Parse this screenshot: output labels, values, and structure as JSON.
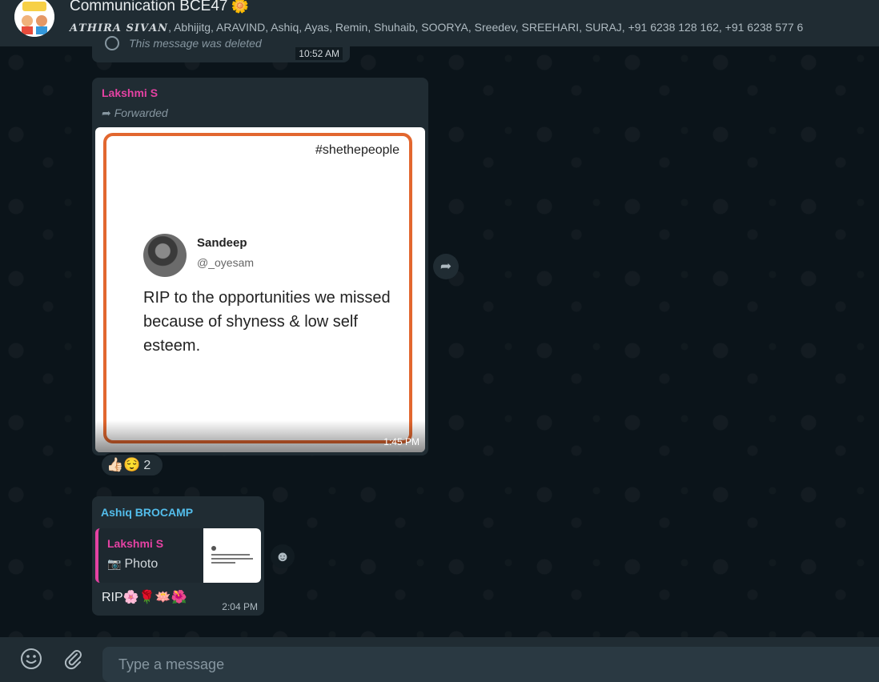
{
  "header": {
    "title": "Communication BCE47",
    "title_emoji": "🌼",
    "members_fancy": "𝑨𝑻𝑯𝑰𝑹𝑨 𝑺𝑰𝑽𝑨𝑵",
    "members_rest": ", Abhijitg, ARAVIND, Ashiq, Ayas, Remin, Shuhaib, SOORYA, Sreedev, SREEHARI, SURAJ, +91 6238 128 162, +91 6238 577 6",
    "avatar_text": "LET'S SPEAK!"
  },
  "messages": {
    "deleted": {
      "text": "This message was deleted",
      "time": "10:52 AM"
    },
    "image_message": {
      "sender": "Lakshmi S",
      "sender_color": "#e542a3",
      "forwarded_label": "Forwarded",
      "time": "1:45 PM",
      "image": {
        "hashtag": "#shethepeople",
        "author_name": "Sandeep",
        "author_handle": "@_oyesam",
        "tweet_text": "RIP to the opportunities we missed because of shyness & low self esteem."
      },
      "reactions": {
        "emojis": "👍🏻😌",
        "count": "2"
      }
    },
    "reply_message": {
      "sender": "Ashiq BROCAMP",
      "sender_color": "#53bdeb",
      "quoted_sender": "Lakshmi S",
      "quoted_type": "Photo",
      "text": "RIP🌸🌹🪷🌺",
      "time": "2:04 PM"
    }
  },
  "composer": {
    "placeholder": "Type a message"
  },
  "icons": [
    "emoji-icon",
    "attach-icon",
    "share-icon",
    "camera-icon",
    "forward-icon",
    "deleted-icon"
  ]
}
